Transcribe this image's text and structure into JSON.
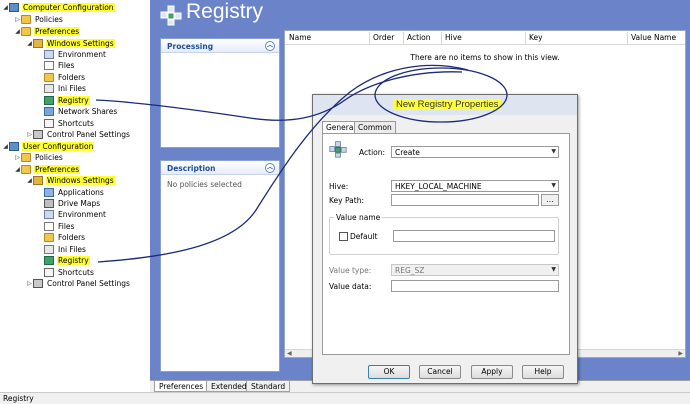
{
  "window": {
    "title": "Registry",
    "status": "Registry"
  },
  "tree": {
    "computer_config": "Computer Configuration",
    "c_policies": "Policies",
    "c_preferences": "Preferences",
    "c_windows_settings": "Windows Settings",
    "c_environment": "Environment",
    "c_files": "Files",
    "c_folders": "Folders",
    "c_ini": "Ini Files",
    "c_registry": "Registry",
    "c_network": "Network Shares",
    "c_shortcuts": "Shortcuts",
    "c_control": "Control Panel Settings",
    "user_config": "User Configuration",
    "u_policies": "Policies",
    "u_preferences": "Preferences",
    "u_windows_settings": "Windows Settings",
    "u_applications": "Applications",
    "u_drive_maps": "Drive Maps",
    "u_environment": "Environment",
    "u_files": "Files",
    "u_folders": "Folders",
    "u_ini": "Ini Files",
    "u_registry": "Registry",
    "u_shortcuts": "Shortcuts",
    "u_control": "Control Panel Settings"
  },
  "panels": {
    "processing": "Processing",
    "description": "Description",
    "description_text": "No policies selected"
  },
  "list": {
    "columns": [
      "Name",
      "Order",
      "Action",
      "Hive",
      "Key",
      "Value Name"
    ],
    "empty_text": "There are no items to show in this view."
  },
  "bottom_tabs": [
    "Preferences",
    "Extended",
    "Standard"
  ],
  "dialog": {
    "title": "New Registry Properties",
    "tabs": [
      "General",
      "Common"
    ],
    "action_label": "Action:",
    "action_value": "Create",
    "hive_label": "Hive:",
    "hive_value": "HKEY_LOCAL_MACHINE",
    "keypath_label": "Key Path:",
    "browse_label": "...",
    "value_name_group": "Value name",
    "default_label": "Default",
    "value_type_label": "Value type:",
    "value_type_value": "REG_SZ",
    "value_data_label": "Value data:",
    "buttons": {
      "ok": "OK",
      "cancel": "Cancel",
      "apply": "Apply",
      "help": "Help"
    }
  },
  "colors": {
    "highlight": "#ffff33",
    "main_bg": "#6b84c9",
    "annotation": "#1b2a7a"
  }
}
